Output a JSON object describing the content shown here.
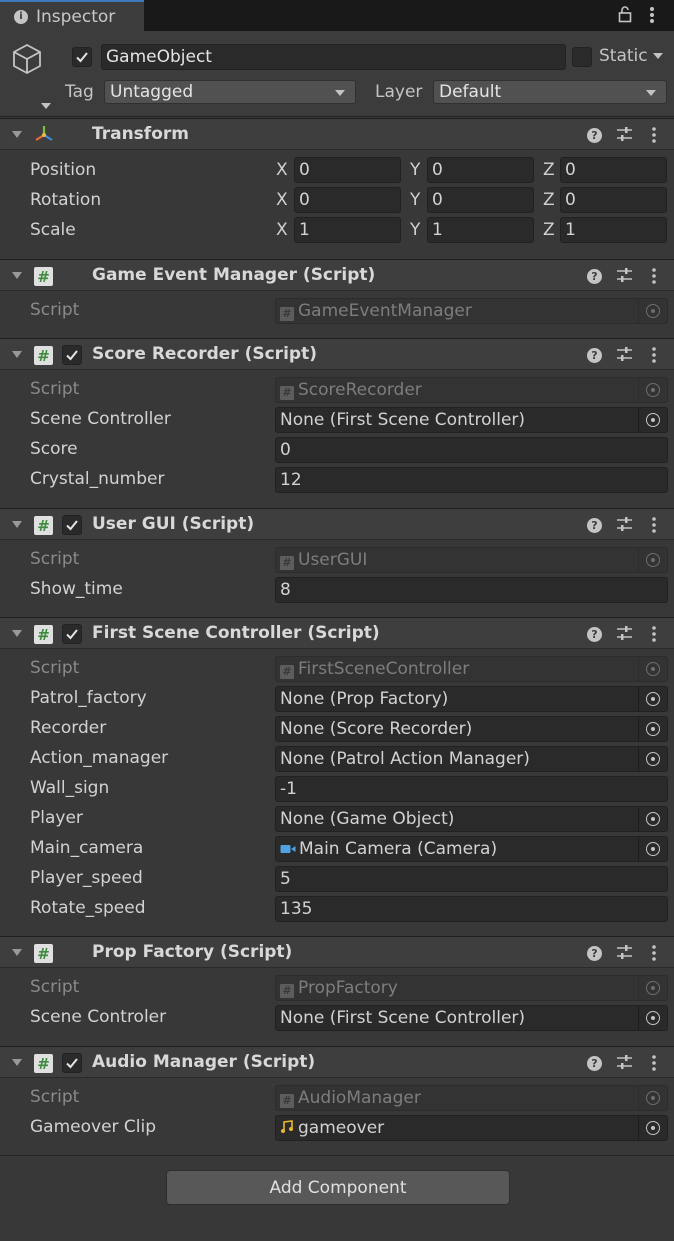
{
  "tab": {
    "title": "Inspector",
    "icons": [
      "info-icon",
      "lock-icon",
      "kebab-menu-icon"
    ]
  },
  "header": {
    "active": true,
    "name": "GameObject",
    "static_label": "Static",
    "tag_label": "Tag",
    "tag_value": "Untagged",
    "layer_label": "Layer",
    "layer_value": "Default"
  },
  "transform": {
    "title": "Transform",
    "rows": [
      {
        "label": "Position",
        "x": "0",
        "y": "0",
        "z": "0"
      },
      {
        "label": "Rotation",
        "x": "0",
        "y": "0",
        "z": "0"
      },
      {
        "label": "Scale",
        "x": "1",
        "y": "1",
        "z": "1"
      }
    ],
    "axes": [
      "X",
      "Y",
      "Z"
    ]
  },
  "components": {
    "game_event_manager": {
      "title": "Game Event Manager (Script)",
      "script_label": "Script",
      "script_value": "GameEventManager"
    },
    "score_recorder": {
      "title": "Score Recorder (Script)",
      "enabled": true,
      "script_label": "Script",
      "script_value": "ScoreRecorder",
      "fields": [
        {
          "label": "Scene Controller",
          "value": "None (First Scene Controller)"
        },
        {
          "label": "Score",
          "value": "0"
        },
        {
          "label": "Crystal_number",
          "value": "12"
        }
      ]
    },
    "user_gui": {
      "title": "User GUI (Script)",
      "enabled": true,
      "script_label": "Script",
      "script_value": "UserGUI",
      "fields": [
        {
          "label": "Show_time",
          "value": "8"
        }
      ]
    },
    "first_scene_controller": {
      "title": "First Scene Controller (Script)",
      "enabled": true,
      "script_label": "Script",
      "script_value": "FirstSceneController",
      "fields": [
        {
          "label": "Patrol_factory",
          "value": "None (Prop Factory)"
        },
        {
          "label": "Recorder",
          "value": "None (Score Recorder)"
        },
        {
          "label": "Action_manager",
          "value": "None (Patrol Action Manager)"
        },
        {
          "label": "Wall_sign",
          "value": "-1"
        },
        {
          "label": "Player",
          "value": "None (Game Object)"
        },
        {
          "label": "Main_camera",
          "value": "Main Camera (Camera)"
        },
        {
          "label": "Player_speed",
          "value": "5"
        },
        {
          "label": "Rotate_speed",
          "value": "135"
        }
      ]
    },
    "prop_factory": {
      "title": "Prop Factory (Script)",
      "script_label": "Script",
      "script_value": "PropFactory",
      "fields": [
        {
          "label": "Scene Controler",
          "value": "None (First Scene Controller)"
        }
      ]
    },
    "audio_manager": {
      "title": "Audio Manager (Script)",
      "enabled": true,
      "script_label": "Script",
      "script_value": "AudioManager",
      "fields": [
        {
          "label": "Gameover Clip",
          "value": "gameover"
        }
      ]
    }
  },
  "add_component_label": "Add Component",
  "colors": {
    "background": "#383838",
    "tab_accent": "#3a79bb",
    "script_icon_green": "#3e8a3e",
    "camera_icon": "#4fa3e0",
    "audio_icon": "#e8b830"
  }
}
